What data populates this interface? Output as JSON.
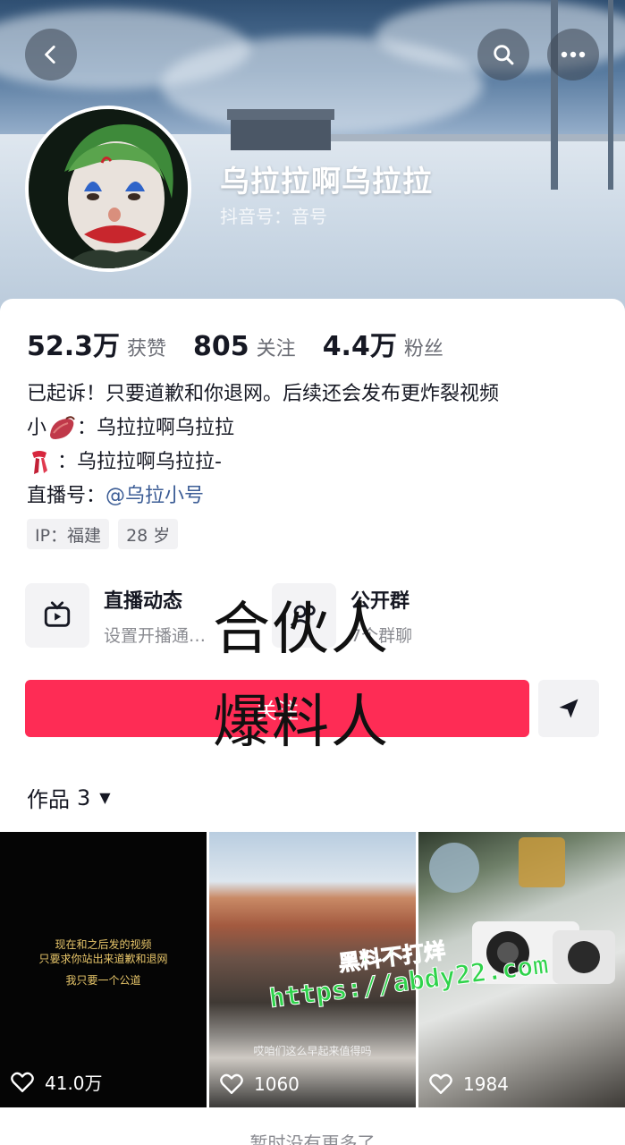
{
  "header": {
    "nickname": "乌拉拉啊乌拉拉",
    "douyin_id": "抖音号：音号",
    "back_icon": "chevron-left-icon",
    "search_icon": "search-icon",
    "more_icon": "more-dots-icon"
  },
  "stats": [
    {
      "value": "52.3万",
      "label": "获赞"
    },
    {
      "value": "805",
      "label": "关注"
    },
    {
      "value": "4.4万",
      "label": "粉丝"
    }
  ],
  "bio": {
    "line1": "已起诉！只要道歉和你退网。后续还会发布更炸裂视频",
    "line2_prefix": "小",
    "line2_text": "：乌拉拉啊乌拉拉",
    "line3_text": "：乌拉拉啊乌拉拉-",
    "line4_prefix": "直播号：",
    "line4_link": "@乌拉小号"
  },
  "tags": [
    "IP：福建",
    "28 岁"
  ],
  "features": [
    {
      "title": "直播动态",
      "subtitle": "设置开播通…",
      "icon": "tv-icon"
    },
    {
      "title": "公开群",
      "subtitle": "7个群聊",
      "icon": "group-icon"
    }
  ],
  "overlay": {
    "line1": "合伙人",
    "line2": "爆料人"
  },
  "actions": {
    "follow_label": "关注",
    "share_icon": "send-icon"
  },
  "works_tab": {
    "label": "作品",
    "count": "3",
    "caret": "▼"
  },
  "videos": [
    {
      "likes": "41.0万",
      "text_lines": [
        "现在和之后发的视频",
        "只要求你站出来道歉和退网",
        "我只要一个公道"
      ]
    },
    {
      "likes": "1060",
      "caption": "哎咱们这么早起来值得吗"
    },
    {
      "likes": "1984"
    }
  ],
  "watermark": {
    "line1": "黑料不打烊",
    "line2": "https://abdy22.com"
  },
  "footer": "暂时没有更多了",
  "colors": {
    "accent": "#fe2c55",
    "link": "#3b5c95",
    "watermark": "#2fd34b"
  }
}
